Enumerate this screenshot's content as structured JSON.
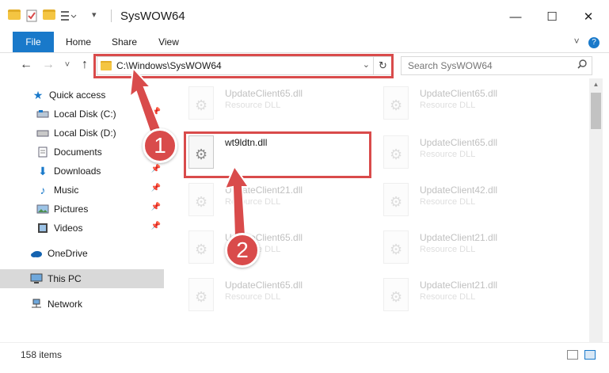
{
  "window": {
    "title": "SysWOW64",
    "minimize_glyph": "—",
    "maximize_glyph": "☐",
    "close_glyph": "✕"
  },
  "ribbon": {
    "tabs": [
      "File",
      "Home",
      "Share",
      "View"
    ],
    "expand_glyph": "˅",
    "help_glyph": "?"
  },
  "address": {
    "back_glyph": "←",
    "forward_glyph": "→",
    "recent_glyph": "˅",
    "up_glyph": "↑",
    "path": "C:\\Windows\\SysWOW64",
    "dropdown_glyph": "⌄",
    "refresh_glyph": "↻"
  },
  "search": {
    "placeholder": "Search SysWOW64",
    "icon": "search-icon"
  },
  "sidebar": {
    "items": [
      {
        "label": "Quick access",
        "icon": "star-icon"
      },
      {
        "label": "Local Disk (C:)",
        "icon": "drive-icon",
        "pinned": true
      },
      {
        "label": "Local Disk (D:)",
        "icon": "drive-icon"
      },
      {
        "label": "Documents",
        "icon": "documents-icon",
        "pinned": true
      },
      {
        "label": "Downloads",
        "icon": "download-icon",
        "pinned": true
      },
      {
        "label": "Music",
        "icon": "music-icon",
        "pinned": true
      },
      {
        "label": "Pictures",
        "icon": "pictures-icon",
        "pinned": true
      },
      {
        "label": "Videos",
        "icon": "videos-icon",
        "pinned": true
      },
      {
        "label": "OneDrive",
        "icon": "cloud-icon"
      },
      {
        "label": "This PC",
        "icon": "computer-icon",
        "selected": true
      },
      {
        "label": "Network",
        "icon": "network-icon"
      }
    ]
  },
  "files": {
    "left": [
      {
        "name": "UpdateClient65.dll",
        "desc": "Resource DLL"
      },
      {
        "name": "wt9ldtn.dll",
        "desc": ""
      },
      {
        "name": "UpdateClient21.dll",
        "desc": "Resource DLL"
      },
      {
        "name": "UpdateClient65.dll",
        "desc": "Resource DLL"
      },
      {
        "name": "UpdateClient65.dll",
        "desc": "Resource DLL"
      }
    ],
    "right": [
      {
        "name": "UpdateClient65.dll",
        "desc": "Resource DLL"
      },
      {
        "name": "UpdateClient65.dll",
        "desc": "Resource DLL"
      },
      {
        "name": "UpdateClient42.dll",
        "desc": "Resource DLL"
      },
      {
        "name": "UpdateClient21.dll",
        "desc": "Resource DLL"
      },
      {
        "name": "UpdateClient21.dll",
        "desc": "Resource DLL"
      }
    ]
  },
  "status": {
    "item_count": "158 items"
  },
  "callouts": {
    "step1": "1",
    "step2": "2"
  },
  "colors": {
    "accent": "#1979ca",
    "highlight_red": "#d94b4b",
    "selected_nav": "#d9d9d9"
  }
}
